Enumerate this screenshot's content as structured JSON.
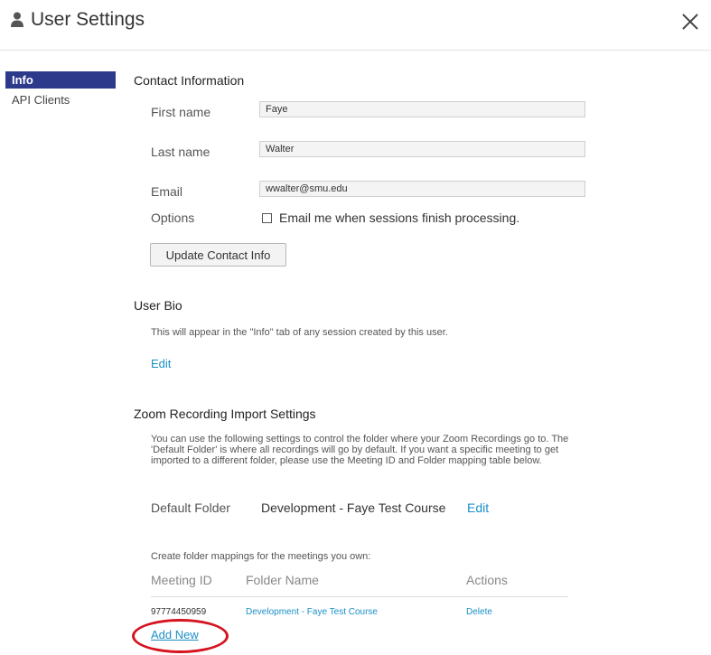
{
  "header": {
    "title": "User Settings",
    "user_icon": "user-icon",
    "close_icon": "close-icon"
  },
  "sidebar": {
    "items": [
      {
        "label": "Info",
        "active": true
      },
      {
        "label": "API Clients",
        "active": false
      }
    ]
  },
  "contact": {
    "title": "Contact Information",
    "first_name_label": "First name",
    "first_name_value": "Faye",
    "last_name_label": "Last name",
    "last_name_value": "Walter",
    "email_label": "Email",
    "email_value": "wwalter@smu.edu",
    "options_label": "Options",
    "options_checkbox_label": "Email me when sessions finish processing.",
    "options_checked": false,
    "update_button": "Update Contact Info"
  },
  "bio": {
    "title": "User Bio",
    "description": "This will appear in the \"Info\" tab of any session created by this user.",
    "edit_link": "Edit"
  },
  "zoom": {
    "title": "Zoom Recording Import Settings",
    "description": "You can use the following settings to control the folder where your Zoom Recordings go to. The 'Default Folder' is where all recordings will go by default. If you want a specific meeting to get imported to a different folder, please use the Meeting ID and Folder mapping table below.",
    "default_folder_label": "Default Folder",
    "default_folder_value": "Development - Faye Test Course",
    "default_folder_edit": "Edit",
    "mappings_intro": "Create folder mappings for the meetings you own:",
    "table": {
      "headers": [
        "Meeting ID",
        "Folder Name",
        "Actions"
      ],
      "rows": [
        {
          "meeting_id": "97774450959",
          "folder_name": "Development - Faye Test Course",
          "action": "Delete"
        }
      ]
    },
    "add_new": "Add New"
  },
  "colors": {
    "sidebar_active_bg": "#2d3a8c",
    "link": "#1a8fc6",
    "annotation": "#d6121e"
  }
}
